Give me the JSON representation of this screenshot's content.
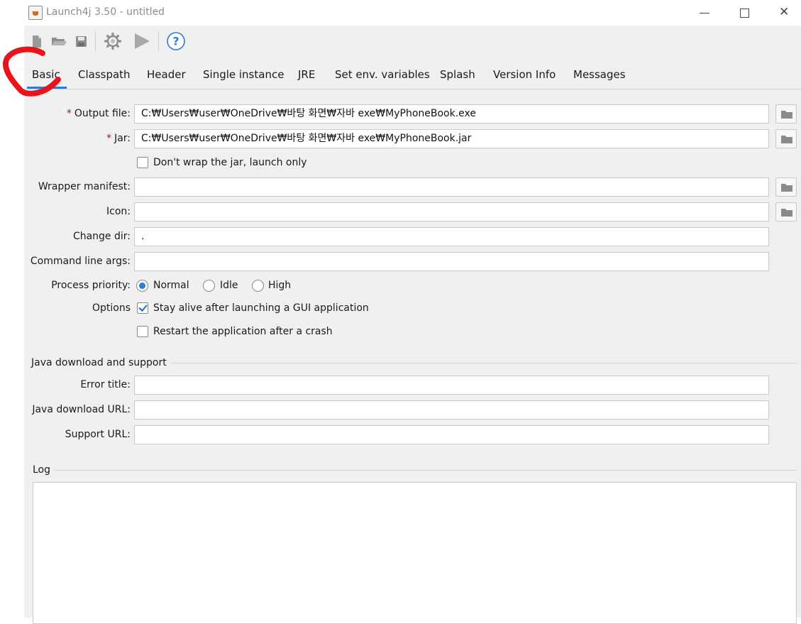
{
  "window": {
    "title": "Launch4j 3.50 - untitled",
    "minimize_icon": "minimize-icon",
    "maximize_icon": "maximize-icon",
    "close_icon": "close-icon"
  },
  "toolbar": {
    "icons": [
      "new-file-icon",
      "open-folder-icon",
      "save-icon",
      "build-gear-icon",
      "run-play-icon",
      "help-icon"
    ]
  },
  "tabs": [
    {
      "label": "Basic",
      "active": true
    },
    {
      "label": "Classpath"
    },
    {
      "label": "Header"
    },
    {
      "label": "Single instance"
    },
    {
      "label": "JRE"
    },
    {
      "label": "Set env. variables"
    },
    {
      "label": "Splash"
    },
    {
      "label": "Version Info"
    },
    {
      "label": "Messages"
    }
  ],
  "basic": {
    "output_file": {
      "required_mark": "*",
      "label": "Output file:",
      "value": "C:₩Users₩user₩OneDrive₩바탕 화면₩자바 exe₩MyPhoneBook.exe"
    },
    "jar": {
      "required_mark": "*",
      "label": "Jar:",
      "value": "C:₩Users₩user₩OneDrive₩바탕 화면₩자바 exe₩MyPhoneBook.jar"
    },
    "dont_wrap": {
      "label": "Don't wrap the jar, launch only",
      "checked": false
    },
    "wrapper_manifest": {
      "label": "Wrapper manifest:",
      "value": ""
    },
    "icon": {
      "label": "Icon:",
      "value": ""
    },
    "change_dir": {
      "label": "Change dir:",
      "value": "."
    },
    "cmd_args": {
      "label": "Command line args:",
      "value": ""
    },
    "process_priority": {
      "label": "Process priority:",
      "options": [
        "Normal",
        "Idle",
        "High"
      ],
      "selected": "Normal"
    },
    "options": {
      "label": "Options",
      "stay_alive": {
        "label": "Stay alive after launching a GUI application",
        "checked": true
      },
      "restart": {
        "label": "Restart the application after a crash",
        "checked": false
      }
    }
  },
  "java_download": {
    "title": "Java download and support",
    "error_title": {
      "label": "Error title:",
      "value": ""
    },
    "download_url": {
      "label": "Java download URL:",
      "value": ""
    },
    "support_url": {
      "label": "Support URL:",
      "value": ""
    }
  },
  "log": {
    "title": "Log",
    "content": ""
  },
  "colors": {
    "accent": "#2f7bd6",
    "required": "#d00000",
    "annotation": "#e8141c",
    "panel_bg": "#f0f0f0"
  }
}
